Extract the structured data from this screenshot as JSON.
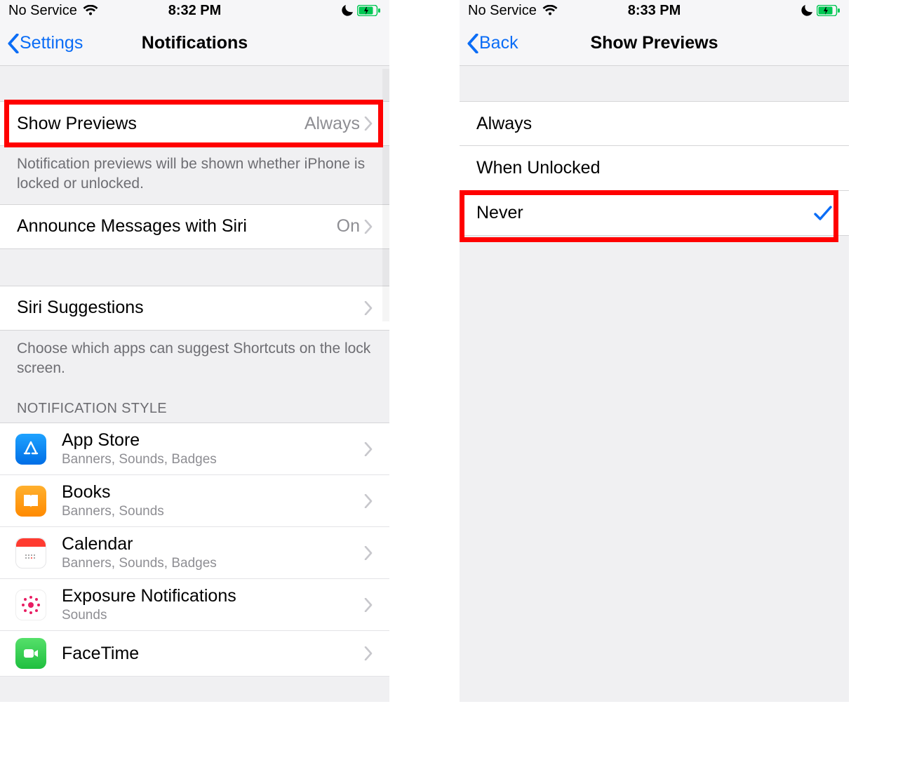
{
  "left": {
    "status": {
      "carrier": "No Service",
      "time": "8:32 PM"
    },
    "nav": {
      "back": "Settings",
      "title": "Notifications"
    },
    "rows": {
      "showPreviews": {
        "label": "Show Previews",
        "value": "Always"
      },
      "announceSiri": {
        "label": "Announce Messages with Siri",
        "value": "On"
      },
      "siriSuggestions": {
        "label": "Siri Suggestions"
      }
    },
    "footnotes": {
      "previews": "Notification previews will be shown whether iPhone is locked or unlocked.",
      "siri": "Choose which apps can suggest Shortcuts on the lock screen."
    },
    "sectionHeader": "NOTIFICATION STYLE",
    "apps": [
      {
        "name": "App Store",
        "sub": "Banners, Sounds, Badges",
        "icon": "appstore"
      },
      {
        "name": "Books",
        "sub": "Banners, Sounds",
        "icon": "books"
      },
      {
        "name": "Calendar",
        "sub": "Banners, Sounds, Badges",
        "icon": "calendar"
      },
      {
        "name": "Exposure Notifications",
        "sub": "Sounds",
        "icon": "exposure"
      },
      {
        "name": "FaceTime",
        "sub": "",
        "icon": "facetime"
      }
    ]
  },
  "right": {
    "status": {
      "carrier": "No Service",
      "time": "8:33 PM"
    },
    "nav": {
      "back": "Back",
      "title": "Show Previews"
    },
    "options": [
      {
        "label": "Always",
        "selected": false
      },
      {
        "label": "When Unlocked",
        "selected": false
      },
      {
        "label": "Never",
        "selected": true
      }
    ]
  }
}
